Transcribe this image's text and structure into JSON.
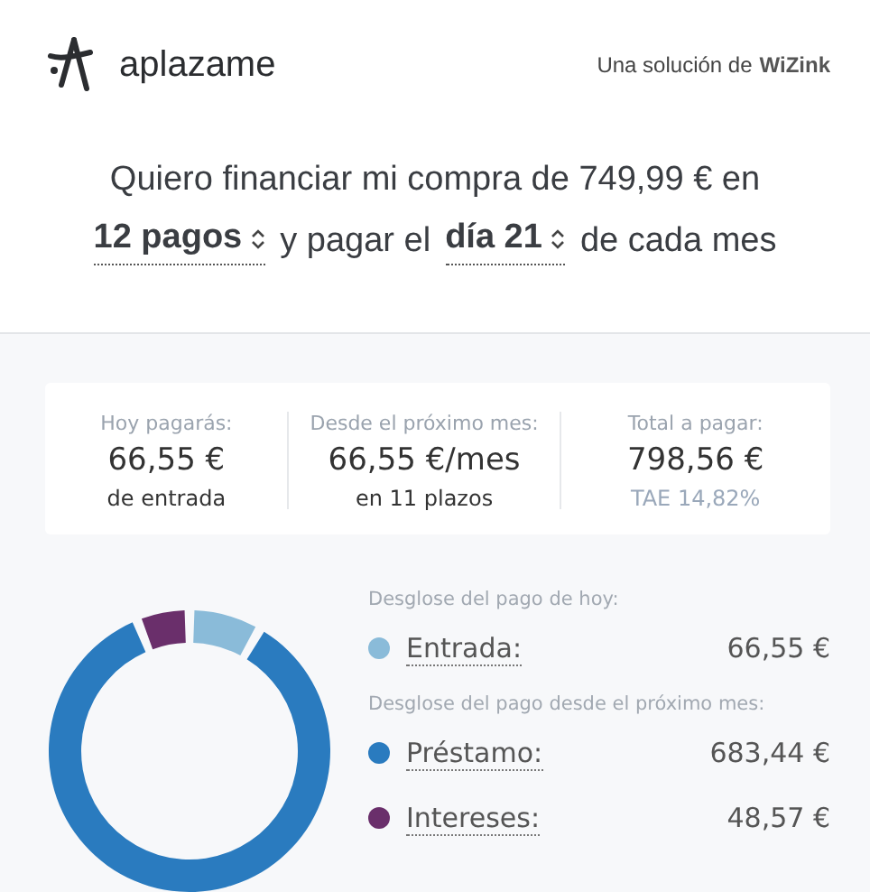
{
  "header": {
    "brand": "aplazame",
    "tagline": "Una solución de",
    "partner": "WiZink"
  },
  "intro": {
    "text_1": "Quiero financiar mi compra de 749,99 € en",
    "installments": "12 pagos",
    "text_2": "y pagar el",
    "day": "día 21",
    "text_3": "de cada mes"
  },
  "summary": [
    {
      "label": "Hoy pagarás:",
      "amount": "66,55 €",
      "note": "de entrada",
      "kind": "plain"
    },
    {
      "label": "Desde el próximo mes:",
      "amount": "66,55 €/mes",
      "note": "en 11 plazos",
      "kind": "plain"
    },
    {
      "label": "Total a pagar:",
      "amount": "798,56 €",
      "note": "TAE 14,82%",
      "kind": "muted"
    }
  ],
  "breakdown": [
    {
      "kind": "heading",
      "text": "Desglose del pago de hoy:"
    },
    {
      "kind": "item",
      "label": "Entrada:",
      "amount": "66,55 €",
      "color": "#8abbd9"
    },
    {
      "kind": "heading",
      "text": "Desglose del pago desde el próximo mes:"
    },
    {
      "kind": "item",
      "label": "Préstamo:",
      "amount": "683,44 €",
      "color": "#2a7bbf"
    },
    {
      "kind": "item",
      "label": "Intereses:",
      "amount": "48,57 €",
      "color": "#6a2f6b"
    }
  ],
  "chart_data": {
    "type": "donut",
    "values": [
      8.33,
      85.59,
      6.08
    ]
  }
}
